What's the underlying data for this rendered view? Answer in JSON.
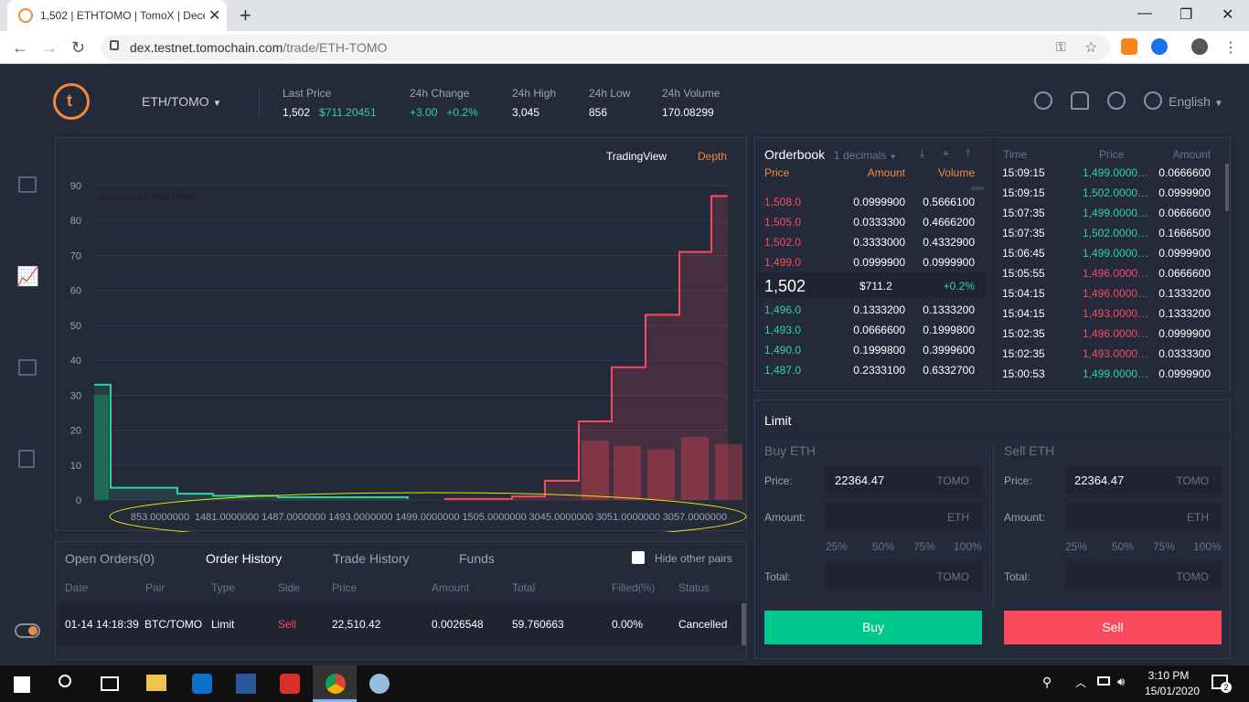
{
  "browser": {
    "tab_title": "1,502 | ETHTOMO | TomoX | Dece",
    "url_domain": "dex.testnet.tomochain.com",
    "url_path": "/trade/ETH-TOMO"
  },
  "header": {
    "pair": "ETH/TOMO",
    "stats": [
      {
        "label": "Last Price",
        "value": "1,502",
        "value2": "$711.20451"
      },
      {
        "label": "24h Change",
        "value": "+3.00",
        "value2": "+0.2%"
      },
      {
        "label": "24h High",
        "value": "3,045"
      },
      {
        "label": "24h Low",
        "value": "856"
      },
      {
        "label": "24h Volume",
        "value": "170.08299"
      }
    ],
    "language": "English"
  },
  "chart": {
    "tabs": [
      "TradingView",
      "Depth"
    ],
    "active_tab": "Depth",
    "credit": "JS chart by amCharts"
  },
  "chart_data": {
    "type": "area",
    "x_tick_labels": [
      "853.0000000",
      "1481.0000000",
      "1487.0000000",
      "1493.0000000",
      "1499.0000000",
      "1505.0000000",
      "3045.0000000",
      "3051.0000000",
      "3057.0000000"
    ],
    "y_ticks": [
      0,
      10,
      20,
      30,
      40,
      50,
      60,
      70,
      80,
      90
    ],
    "ylim": [
      0,
      90
    ],
    "bids_step": [
      33,
      3.5,
      1.8,
      1.2,
      0.8,
      0.3
    ],
    "asks_step": [
      0.3,
      1,
      5.5,
      22.5,
      38,
      53,
      71,
      87
    ],
    "bid_bar": [
      30
    ],
    "ask_bars": [
      17,
      15.5,
      14.5,
      18,
      16
    ],
    "colors": {
      "bid": "#2cd3a0",
      "ask": "#f94a5d"
    }
  },
  "orders": {
    "tabs": [
      "Open Orders(0)",
      "Order History",
      "Trade History",
      "Funds"
    ],
    "active_tab": "Order History",
    "hide_other_pairs": "Hide other pairs",
    "columns": [
      "Date",
      "Pair",
      "Type",
      "Side",
      "Price",
      "Amount",
      "Total",
      "Filled(%)",
      "Status"
    ],
    "rows": [
      {
        "date": "01-14 14:18:39",
        "pair": "BTC/TOMO",
        "type": "Limit",
        "side": "Sell",
        "price": "22,510.42",
        "amount": "0.0026548",
        "total": "59.760663",
        "filled": "0.00%",
        "status": "Cancelled"
      }
    ]
  },
  "orderbook": {
    "title": "Orderbook",
    "decimals": "1 decimals",
    "columns": [
      "Price",
      "Amount",
      "Volume"
    ],
    "asks": [
      {
        "price": "1,508.0",
        "amount": "0.0999900",
        "volume": "0.5666100"
      },
      {
        "price": "1,505.0",
        "amount": "0.0333300",
        "volume": "0.4666200"
      },
      {
        "price": "1,502.0",
        "amount": "0.3333000",
        "volume": "0.4332900"
      },
      {
        "price": "1,499.0",
        "amount": "0.0999900",
        "volume": "0.0999900"
      }
    ],
    "mid_price": "1,502",
    "mid_usd": "$711.2",
    "mid_change": "+0.2%",
    "bids": [
      {
        "price": "1,496.0",
        "amount": "0.1333200",
        "volume": "0.1333200"
      },
      {
        "price": "1,493.0",
        "amount": "0.0666600",
        "volume": "0.1999800"
      },
      {
        "price": "1,490.0",
        "amount": "0.1999800",
        "volume": "0.3999600"
      },
      {
        "price": "1,487.0",
        "amount": "0.2333100",
        "volume": "0.6332700"
      }
    ]
  },
  "trades": {
    "columns": [
      "Time",
      "Price",
      "Amount"
    ],
    "rows": [
      {
        "time": "15:09:15",
        "price": "1,499.0000…",
        "amount": "0.0666600",
        "side": "buy"
      },
      {
        "time": "15:09:15",
        "price": "1,502.0000…",
        "amount": "0.0999900",
        "side": "buy"
      },
      {
        "time": "15:07:35",
        "price": "1,499.0000…",
        "amount": "0.0666600",
        "side": "buy"
      },
      {
        "time": "15:07:35",
        "price": "1,502.0000…",
        "amount": "0.1666500",
        "side": "buy"
      },
      {
        "time": "15:06:45",
        "price": "1,499.0000…",
        "amount": "0.0999900",
        "side": "buy"
      },
      {
        "time": "15:05:55",
        "price": "1,496.0000…",
        "amount": "0.0666600",
        "side": "sell"
      },
      {
        "time": "15:04:15",
        "price": "1,496.0000…",
        "amount": "0.1333200",
        "side": "sell"
      },
      {
        "time": "15:04:15",
        "price": "1,493.0000…",
        "amount": "0.1333200",
        "side": "sell"
      },
      {
        "time": "15:02:35",
        "price": "1,496.0000…",
        "amount": "0.0999900",
        "side": "sell"
      },
      {
        "time": "15:02:35",
        "price": "1,493.0000…",
        "amount": "0.0333300",
        "side": "sell"
      },
      {
        "time": "15:00:53",
        "price": "1,499.0000…",
        "amount": "0.0999900",
        "side": "buy"
      }
    ]
  },
  "limit": {
    "title": "Limit",
    "buy": {
      "title": "Buy ETH",
      "price": "22364.47",
      "amount": "",
      "button": "Buy"
    },
    "sell": {
      "title": "Sell ETH",
      "price": "22364.47",
      "amount": "",
      "button": "Sell"
    },
    "labels": {
      "price": "Price:",
      "amount": "Amount:",
      "total": "Total:"
    },
    "units": {
      "quote": "TOMO",
      "base": "ETH"
    },
    "percents": [
      "25%",
      "50%",
      "75%",
      "100%"
    ]
  },
  "taskbar": {
    "time": "3:10 PM",
    "date": "15/01/2020",
    "notifications": "2"
  }
}
